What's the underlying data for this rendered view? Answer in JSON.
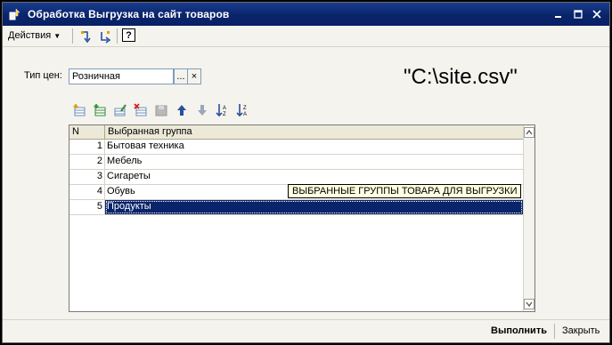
{
  "window": {
    "title": "Обработка  Выгрузка на сайт товаров",
    "minimize_icon": "minimize-icon",
    "maximize_icon": "maximize-icon",
    "close_icon": "close-icon"
  },
  "menu": {
    "actions_label": "Действия",
    "help_label": "?"
  },
  "form": {
    "price_type_label": "Тип цен:",
    "price_type_value": "Розничная",
    "select_button": "...",
    "clear_button": "×",
    "file_path": "\"C:\\site.csv\""
  },
  "grid": {
    "headers": {
      "n": "N",
      "group": "Выбранная группа"
    },
    "rows": [
      {
        "n": "1",
        "group": "Бытовая техника"
      },
      {
        "n": "2",
        "group": "Мебель"
      },
      {
        "n": "3",
        "group": "Сигареты"
      },
      {
        "n": "4",
        "group": "Обувь"
      },
      {
        "n": "5",
        "group": "Продукты"
      }
    ],
    "tooltip": "ВЫБРАННЫЕ ГРУППЫ ТОВАРА ДЛЯ ВЫГРУЗКИ"
  },
  "buttons": {
    "run": "Выполнить",
    "close": "Закрыть"
  },
  "colors": {
    "titlebar": "#0a246a",
    "selection": "#0a246a",
    "tooltip_bg": "#ffffe1"
  }
}
